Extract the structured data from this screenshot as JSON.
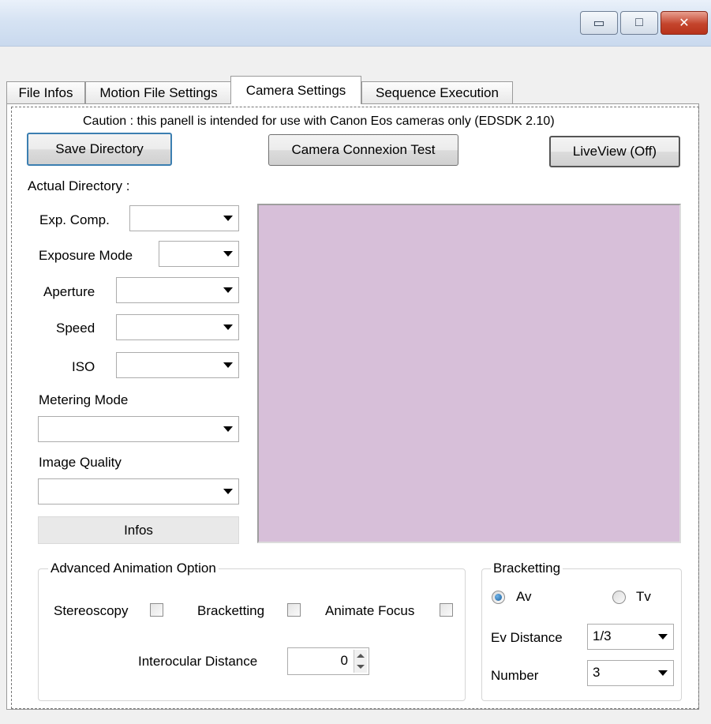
{
  "window": {
    "minimize_glyph": "▭",
    "maximize_glyph": "□",
    "close_glyph": "✕"
  },
  "tabs": [
    {
      "label": "File Infos"
    },
    {
      "label": "Motion File Settings"
    },
    {
      "label": "Camera Settings"
    },
    {
      "label": "Sequence Execution"
    }
  ],
  "camera": {
    "caution": "Caution : this panell is intended for use with Canon Eos cameras only (EDSDK 2.10)",
    "save_directory": "Save Directory",
    "connexion_test": "Camera Connexion Test",
    "liveview": "LiveView (Off)",
    "actual_directory": "Actual Directory :",
    "exp_comp_label": "Exp. Comp.",
    "exposure_mode_label": "Exposure Mode",
    "aperture_label": "Aperture",
    "speed_label": "Speed",
    "iso_label": "ISO",
    "metering_mode_label": "Metering Mode",
    "image_quality_label": "Image Quality",
    "infos": "Infos"
  },
  "advanced": {
    "title": "Advanced Animation Option",
    "stereoscopy": "Stereoscopy",
    "bracketting": "Bracketting",
    "animate_focus": "Animate Focus",
    "interocular_label": "Interocular Distance",
    "interocular_value": "0"
  },
  "bracketting": {
    "title": "Bracketting",
    "av": "Av",
    "tv": "Tv",
    "ev_distance_label": "Ev Distance",
    "ev_distance_value": "1/3",
    "number_label": "Number",
    "number_value": "3"
  },
  "colors": {
    "liveview_bg": "#d7bfd9",
    "titlebar": "#d6e3f3",
    "close_button": "#c4442c"
  }
}
